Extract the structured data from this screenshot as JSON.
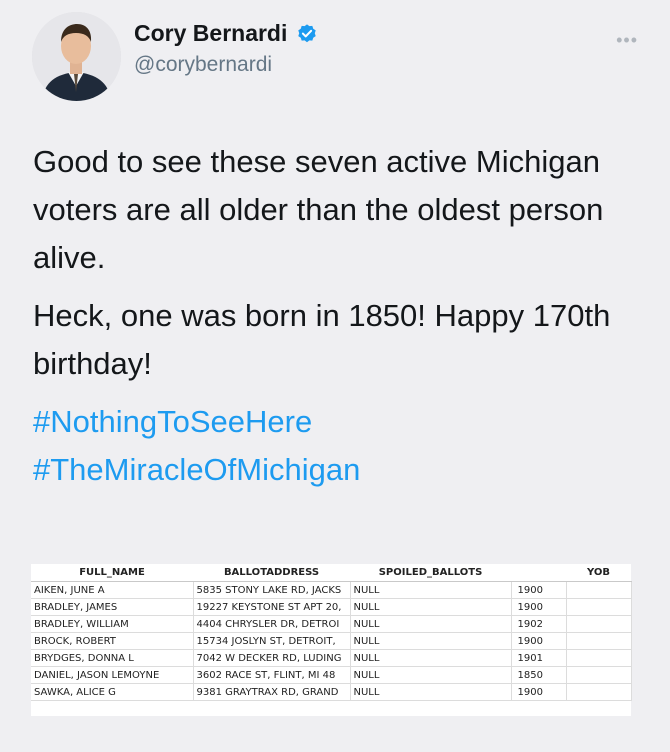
{
  "tweet": {
    "author": {
      "display_name": "Cory Bernardi",
      "handle": "@corybernardi",
      "verified": true,
      "avatar_icon": "profile-photo"
    },
    "menu_icon": "more-options-icon",
    "paragraphs": [
      "Good to see these seven active Michigan voters are all older than the oldest person alive.",
      "Heck, one was born in 1850! Happy 170th birthday!"
    ],
    "hashtags": [
      "#NothingToSeeHere",
      "#TheMiracleOfMichigan"
    ],
    "colors": {
      "background": "#efeff2",
      "text": "#14171a",
      "secondary": "#657786",
      "link": "#1d9bf0",
      "verified": "#1d9bf0"
    }
  },
  "table": {
    "headers": [
      "FULL_NAME",
      "BALLOTADDRESS",
      "SPOILED_BALLOTS",
      "",
      "YOB"
    ],
    "rows": [
      [
        "AIKEN, JUNE A",
        "5835 STONY LAKE RD, JACKS",
        "NULL",
        "1900",
        ""
      ],
      [
        "BRADLEY, JAMES",
        "19227 KEYSTONE ST APT 20,",
        "NULL",
        "1900",
        ""
      ],
      [
        "BRADLEY, WILLIAM",
        "4404 CHRYSLER DR, DETROI",
        "NULL",
        "1902",
        ""
      ],
      [
        "BROCK, ROBERT",
        "15734 JOSLYN ST, DETROIT,",
        "NULL",
        "1900",
        ""
      ],
      [
        "BRYDGES, DONNA L",
        "7042 W DECKER RD, LUDING",
        "NULL",
        "1901",
        ""
      ],
      [
        "DANIEL, JASON LEMOYNE",
        "3602 RACE ST, FLINT, MI 48",
        "NULL",
        "1850",
        ""
      ],
      [
        "SAWKA, ALICE G",
        "9381 GRAYTRAX RD, GRAND",
        "NULL",
        "1900",
        ""
      ]
    ]
  }
}
